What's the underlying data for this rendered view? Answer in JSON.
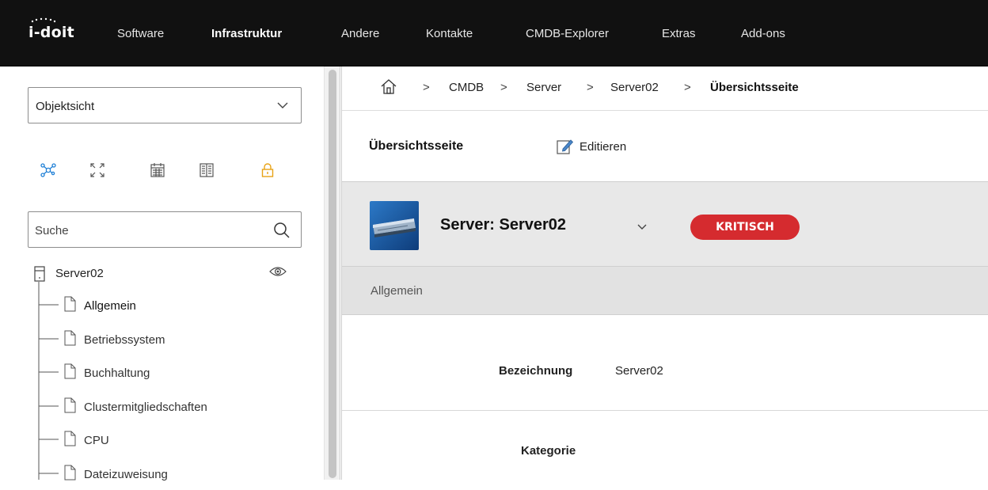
{
  "app": {
    "logo": "i-doit"
  },
  "nav": {
    "items": [
      {
        "label": "Software",
        "active": false
      },
      {
        "label": "Infrastruktur",
        "active": true
      },
      {
        "label": "Andere",
        "active": false
      },
      {
        "label": "Kontakte",
        "active": false
      },
      {
        "label": "CMDB-Explorer",
        "active": false
      },
      {
        "label": "Extras",
        "active": false
      },
      {
        "label": "Add-ons",
        "active": false
      }
    ]
  },
  "sidebar": {
    "view_select": {
      "value": "Objektsicht"
    },
    "tools": [
      "network-icon",
      "expand-icon",
      "calendar-icon",
      "book-icon",
      "lock-icon"
    ],
    "search": {
      "placeholder": "Suche"
    },
    "tree": {
      "root": "Server02",
      "items": [
        {
          "label": "Allgemein"
        },
        {
          "label": "Betriebssystem"
        },
        {
          "label": "Buchhaltung"
        },
        {
          "label": "Clustermitgliedschaften"
        },
        {
          "label": "CPU"
        },
        {
          "label": "Dateizuweisung"
        }
      ]
    }
  },
  "breadcrumb": {
    "separator": ">",
    "items": [
      "CMDB",
      "Server",
      "Server02"
    ],
    "current": "Übersichtsseite"
  },
  "page": {
    "title": "Übersichtsseite",
    "edit_label": "Editieren"
  },
  "object": {
    "title": "Server: Server02",
    "status": "KRITISCH",
    "status_color": "#d52b2f"
  },
  "tabs": {
    "active": "Allgemein"
  },
  "fields": [
    {
      "label": "Bezeichnung",
      "value": "Server02"
    },
    {
      "label": "Kategorie",
      "value": ""
    }
  ],
  "colors": {
    "topbar": "#111111",
    "accent_blue": "#1e7fd6",
    "lock_orange": "#e8a316"
  }
}
